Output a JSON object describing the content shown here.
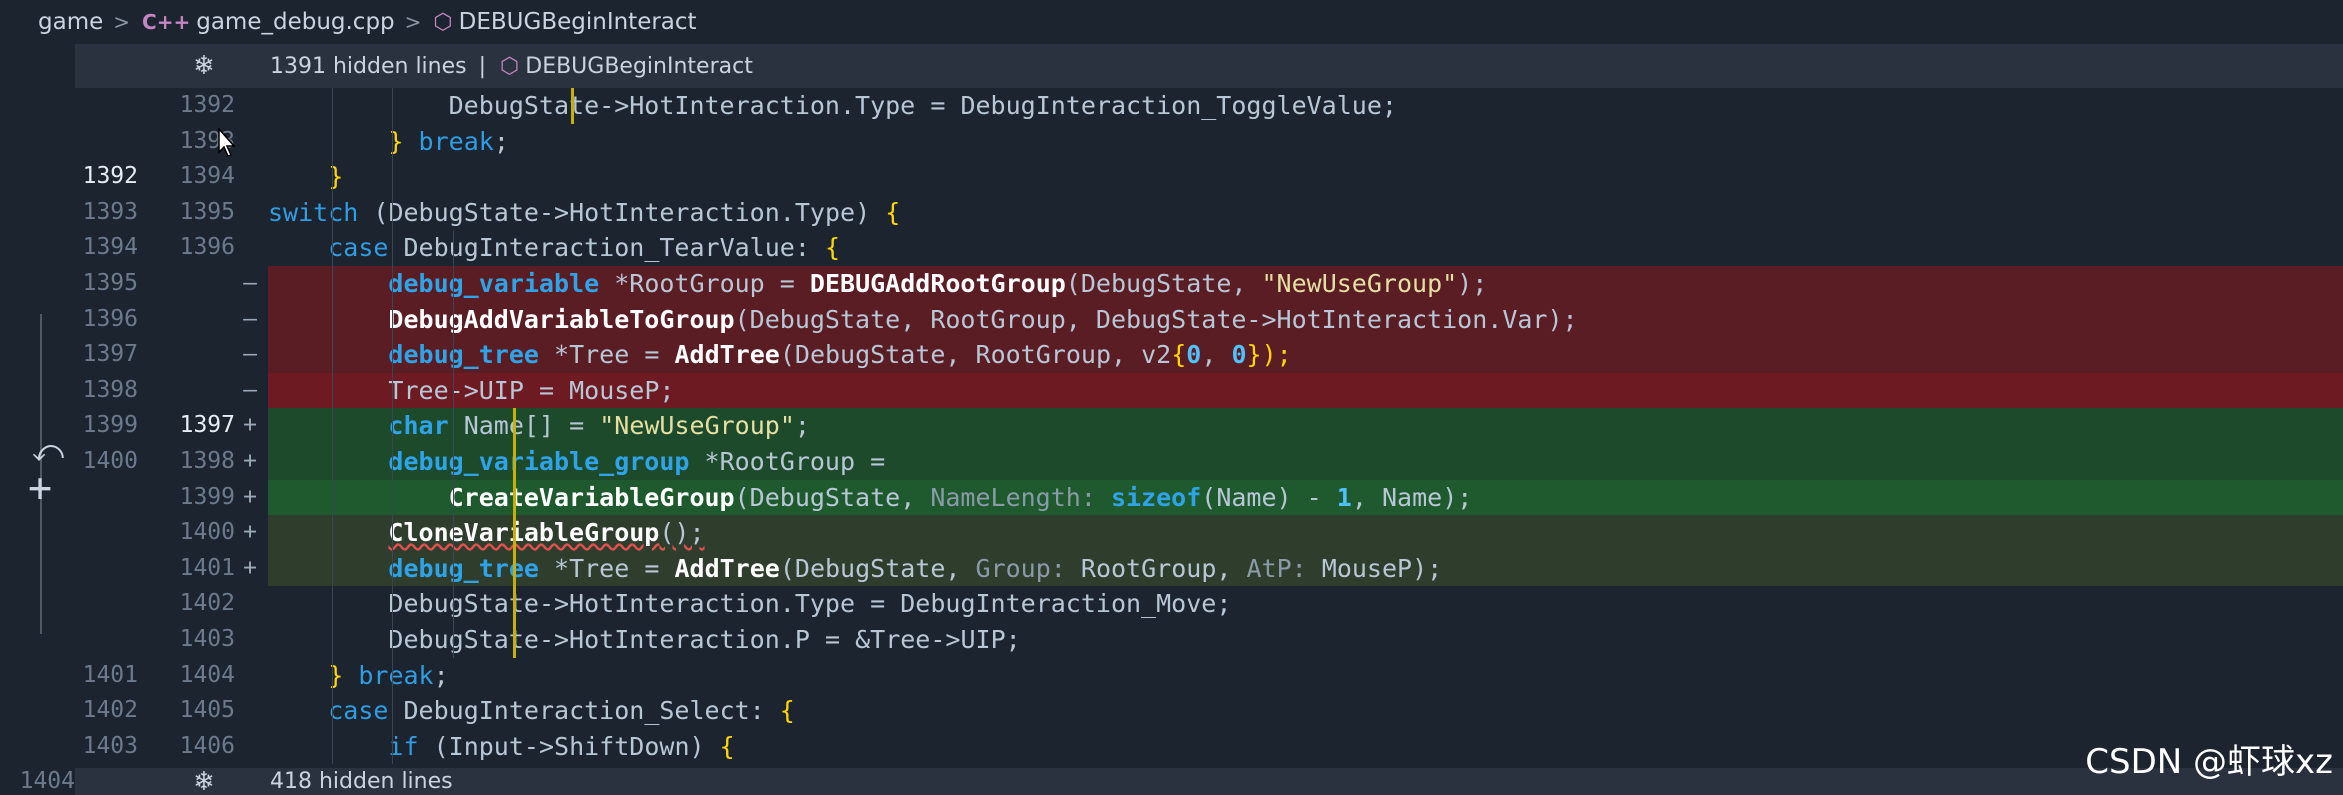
{
  "breadcrumb": {
    "items": [
      "game",
      "game_debug.cpp",
      "DEBUGBeginInteract"
    ]
  },
  "fold_top": {
    "text": "1391 hidden lines",
    "symbol": "DEBUGBeginInteract"
  },
  "fold_bottom": {
    "text": "418 hidden lines",
    "partial_line_number": "1404"
  },
  "watermark": "CSDN @虾球xz",
  "colors": {
    "deleted_bg": "#5a1d24",
    "added_bg": "#1c4a2a",
    "keyword": "#2f9de2",
    "string": "#e6dfa3"
  },
  "lines": [
    {
      "orig": "",
      "mod": "1392",
      "marker": "",
      "type": "normal",
      "text": "            DebugState->HotInteraction.Type = DebugInteraction_ToggleValue;"
    },
    {
      "orig": "",
      "mod": "1393",
      "marker": "",
      "type": "normal",
      "text": "        } break;"
    },
    {
      "orig": "1392",
      "mod": "1394",
      "marker": "",
      "type": "normal",
      "text": "    }"
    },
    {
      "orig": "1393",
      "mod": "1395",
      "marker": "",
      "type": "normal",
      "text": "switch (DebugState->HotInteraction.Type) {"
    },
    {
      "orig": "1394",
      "mod": "1396",
      "marker": "",
      "type": "normal",
      "text": "    case DebugInteraction_TearValue: {"
    },
    {
      "orig": "1395",
      "mod": "",
      "marker": "—",
      "type": "del",
      "text": "        debug_variable *RootGroup = DEBUGAddRootGroup(DebugState, \"NewUseGroup\");"
    },
    {
      "orig": "1396",
      "mod": "",
      "marker": "—",
      "type": "del",
      "text": "        DebugAddVariableToGroup(DebugState, RootGroup, DebugState->HotInteraction.Var);"
    },
    {
      "orig": "1397",
      "mod": "",
      "marker": "—",
      "type": "del",
      "text": "        debug_tree *Tree = AddTree(DebugState, RootGroup, v2{0, 0});"
    },
    {
      "orig": "1398",
      "mod": "",
      "marker": "—",
      "type": "del-strong",
      "text": "        Tree->UIP = MouseP;"
    },
    {
      "orig": "1399",
      "mod": "1397",
      "marker": "+",
      "type": "add",
      "text": "        char Name[] = \"NewUseGroup\";"
    },
    {
      "orig": "1400",
      "mod": "1398",
      "marker": "+",
      "type": "add",
      "text": "        debug_variable_group *RootGroup ="
    },
    {
      "orig": "",
      "mod": "1399",
      "marker": "+",
      "type": "add-strong",
      "text": "            CreateVariableGroup(DebugState, NameLength: sizeof(Name) - 1, Name);"
    },
    {
      "orig": "",
      "mod": "1400",
      "marker": "+",
      "type": "add-soft",
      "text": "        CloneVariableGroup();"
    },
    {
      "orig": "",
      "mod": "1401",
      "marker": "+",
      "type": "add-soft",
      "text": "        debug_tree *Tree = AddTree(DebugState, Group: RootGroup, AtP: MouseP);"
    },
    {
      "orig": "",
      "mod": "1402",
      "marker": "",
      "type": "normal",
      "text": "        DebugState->HotInteraction.Type = DebugInteraction_Move;"
    },
    {
      "orig": "",
      "mod": "1403",
      "marker": "",
      "type": "normal",
      "text": "        DebugState->HotInteraction.P = &Tree->UIP;"
    },
    {
      "orig": "1401",
      "mod": "1404",
      "marker": "",
      "type": "normal",
      "text": "    } break;"
    },
    {
      "orig": "1402",
      "mod": "1405",
      "marker": "",
      "type": "normal",
      "text": "    case DebugInteraction_Select: {"
    },
    {
      "orig": "1403",
      "mod": "1406",
      "marker": "",
      "type": "normal",
      "text": "        if (Input->ShiftDown) {"
    }
  ]
}
